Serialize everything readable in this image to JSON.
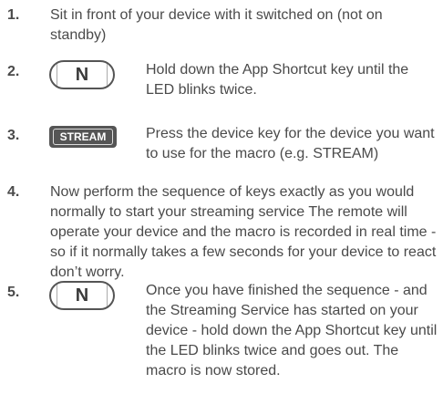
{
  "steps": [
    {
      "number": "1.",
      "text": "Sit in front of your device with it switched on (not on standby)"
    },
    {
      "number": "2.",
      "key_icon": "n-key-icon",
      "key_label": "N",
      "text": "Hold down the App Shortcut key until the LED blinks twice."
    },
    {
      "number": "3.",
      "key_icon": "stream-key-icon",
      "key_label": "STREAM",
      "text": "Press the device key for the device you want to use for the macro (e.g. STREAM)"
    },
    {
      "number": "4.",
      "text": "Now perform the sequence of keys exactly as you would normally to start your streaming service The remote will operate your device and the macro is recorded in real time - so if it normally takes a few seconds for your device to react don’t worry."
    },
    {
      "number": "5.",
      "key_icon": "n-key-icon",
      "key_label": "N",
      "text": "Once you have finished the sequence - and the Streaming Service has started on your device - hold down the App Shortcut key until the LED blinks twice and goes out. The macro is now stored."
    }
  ]
}
